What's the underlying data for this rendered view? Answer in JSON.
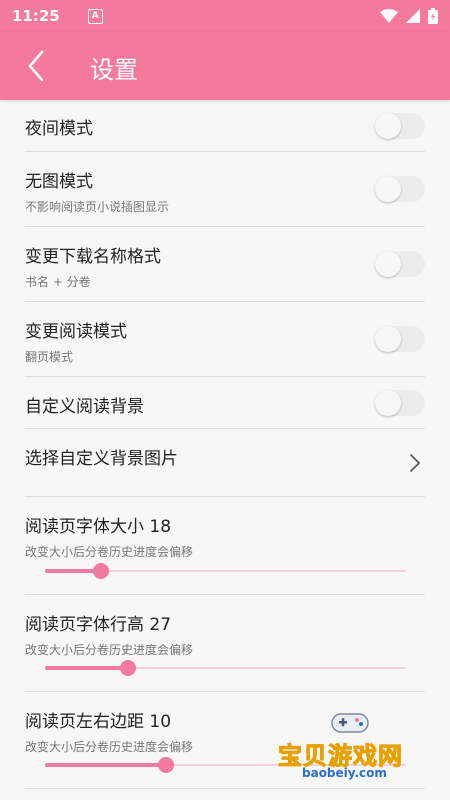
{
  "status_bar": {
    "time": "11:25",
    "notification_letter": "A"
  },
  "app_bar": {
    "title": "设置"
  },
  "settings": {
    "night_mode": {
      "label": "夜间模式",
      "enabled": false
    },
    "no_image_mode": {
      "label": "无图模式",
      "sub": "不影响阅读页小说插图显示",
      "enabled": false
    },
    "download_name_format": {
      "label": "变更下载名称格式",
      "sub": "书名 + 分卷",
      "enabled": false
    },
    "reading_mode": {
      "label": "变更阅读模式",
      "sub": "翻页模式",
      "enabled": false
    },
    "custom_background": {
      "label": "自定义阅读背景",
      "enabled": false
    },
    "choose_background_image": {
      "label": "选择自定义背景图片"
    },
    "font_size": {
      "label": "阅读页字体大小 18",
      "sub": "改变大小后分卷历史进度会偏移",
      "fraction": 0.155
    },
    "line_height": {
      "label": "阅读页字体行高 27",
      "sub": "改变大小后分卷历史进度会偏移",
      "fraction": 0.23
    },
    "margin": {
      "label": "阅读页左右边距 10",
      "sub": "改变大小后分卷历史进度会偏移",
      "fraction": 0.335
    }
  },
  "watermark": {
    "name": "宝贝游戏网",
    "domain": "baobeiy.com"
  },
  "colors": {
    "accent": "#f47a9c",
    "slider": "#f07aa0",
    "slider_track": "#f9cdd9",
    "background": "#f7f7f7"
  }
}
